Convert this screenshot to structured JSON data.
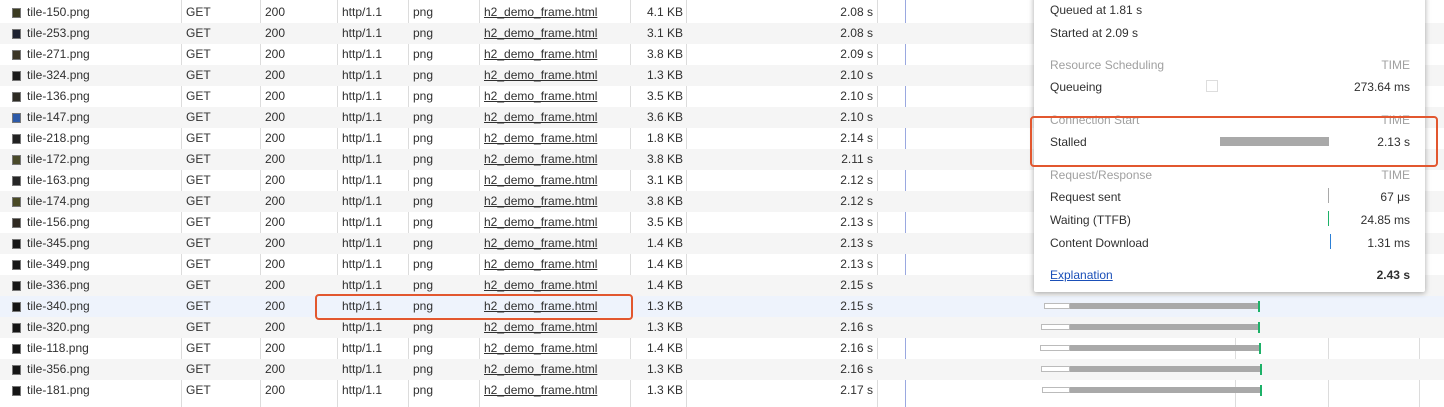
{
  "rows": [
    {
      "name": "tile-150.png",
      "method": "GET",
      "status": "200",
      "protocol": "http/1.1",
      "type": "png",
      "initiator": "h2_demo_frame.html",
      "size": "4.1 KB",
      "time": "2.08 s",
      "thumb": "#3b3b22"
    },
    {
      "name": "tile-253.png",
      "method": "GET",
      "status": "200",
      "protocol": "http/1.1",
      "type": "png",
      "initiator": "h2_demo_frame.html",
      "size": "3.1 KB",
      "time": "2.08 s",
      "thumb": "#1e2230"
    },
    {
      "name": "tile-271.png",
      "method": "GET",
      "status": "200",
      "protocol": "http/1.1",
      "type": "png",
      "initiator": "h2_demo_frame.html",
      "size": "3.8 KB",
      "time": "2.09 s",
      "thumb": "#3a3526"
    },
    {
      "name": "tile-324.png",
      "method": "GET",
      "status": "200",
      "protocol": "http/1.1",
      "type": "png",
      "initiator": "h2_demo_frame.html",
      "size": "1.3 KB",
      "time": "2.10 s",
      "thumb": "#1b1b1b"
    },
    {
      "name": "tile-136.png",
      "method": "GET",
      "status": "200",
      "protocol": "http/1.1",
      "type": "png",
      "initiator": "h2_demo_frame.html",
      "size": "3.5 KB",
      "time": "2.10 s",
      "thumb": "#2e2c24"
    },
    {
      "name": "tile-147.png",
      "method": "GET",
      "status": "200",
      "protocol": "http/1.1",
      "type": "png",
      "initiator": "h2_demo_frame.html",
      "size": "3.6 KB",
      "time": "2.10 s",
      "thumb": "#2d5aa8"
    },
    {
      "name": "tile-218.png",
      "method": "GET",
      "status": "200",
      "protocol": "http/1.1",
      "type": "png",
      "initiator": "h2_demo_frame.html",
      "size": "1.8 KB",
      "time": "2.14 s",
      "thumb": "#222"
    },
    {
      "name": "tile-172.png",
      "method": "GET",
      "status": "200",
      "protocol": "http/1.1",
      "type": "png",
      "initiator": "h2_demo_frame.html",
      "size": "3.8 KB",
      "time": "2.11 s",
      "thumb": "#4a4a2a"
    },
    {
      "name": "tile-163.png",
      "method": "GET",
      "status": "200",
      "protocol": "http/1.1",
      "type": "png",
      "initiator": "h2_demo_frame.html",
      "size": "3.1 KB",
      "time": "2.12 s",
      "thumb": "#262626"
    },
    {
      "name": "tile-174.png",
      "method": "GET",
      "status": "200",
      "protocol": "http/1.1",
      "type": "png",
      "initiator": "h2_demo_frame.html",
      "size": "3.8 KB",
      "time": "2.12 s",
      "thumb": "#4a4a26"
    },
    {
      "name": "tile-156.png",
      "method": "GET",
      "status": "200",
      "protocol": "http/1.1",
      "type": "png",
      "initiator": "h2_demo_frame.html",
      "size": "3.5 KB",
      "time": "2.13 s",
      "thumb": "#2f2a22"
    },
    {
      "name": "tile-345.png",
      "method": "GET",
      "status": "200",
      "protocol": "http/1.1",
      "type": "png",
      "initiator": "h2_demo_frame.html",
      "size": "1.4 KB",
      "time": "2.13 s",
      "thumb": "#151515"
    },
    {
      "name": "tile-349.png",
      "method": "GET",
      "status": "200",
      "protocol": "http/1.1",
      "type": "png",
      "initiator": "h2_demo_frame.html",
      "size": "1.4 KB",
      "time": "2.13 s",
      "thumb": "#151515"
    },
    {
      "name": "tile-336.png",
      "method": "GET",
      "status": "200",
      "protocol": "http/1.1",
      "type": "png",
      "initiator": "h2_demo_frame.html",
      "size": "1.4 KB",
      "time": "2.15 s",
      "thumb": "#151515"
    },
    {
      "name": "tile-340.png",
      "method": "GET",
      "status": "200",
      "protocol": "http/1.1",
      "type": "png",
      "initiator": "h2_demo_frame.html",
      "size": "1.3 KB",
      "time": "2.15 s",
      "thumb": "#151515"
    },
    {
      "name": "tile-320.png",
      "method": "GET",
      "status": "200",
      "protocol": "http/1.1",
      "type": "png",
      "initiator": "h2_demo_frame.html",
      "size": "1.3 KB",
      "time": "2.16 s",
      "thumb": "#151515"
    },
    {
      "name": "tile-118.png",
      "method": "GET",
      "status": "200",
      "protocol": "http/1.1",
      "type": "png",
      "initiator": "h2_demo_frame.html",
      "size": "1.4 KB",
      "time": "2.16 s",
      "thumb": "#151515"
    },
    {
      "name": "tile-356.png",
      "method": "GET",
      "status": "200",
      "protocol": "http/1.1",
      "type": "png",
      "initiator": "h2_demo_frame.html",
      "size": "1.3 KB",
      "time": "2.16 s",
      "thumb": "#151515"
    },
    {
      "name": "tile-181.png",
      "method": "GET",
      "status": "200",
      "protocol": "http/1.1",
      "type": "png",
      "initiator": "h2_demo_frame.html",
      "size": "1.3 KB",
      "time": "2.17 s",
      "thumb": "#151515"
    }
  ],
  "timing_popup": {
    "queued_at": "Queued at 1.81 s",
    "started_at": "Started at 2.09 s",
    "resource_scheduling": "Resource Scheduling",
    "time_header": "TIME",
    "queueing_label": "Queueing",
    "queueing_value": "273.64 ms",
    "connection_start": "Connection Start",
    "stalled_label": "Stalled",
    "stalled_value": "2.13 s",
    "request_response": "Request/Response",
    "request_sent_label": "Request sent",
    "request_sent_value": "67 μs",
    "ttfb_label": "Waiting (TTFB)",
    "ttfb_value": "24.85 ms",
    "download_label": "Content Download",
    "download_value": "1.31 ms",
    "explanation_link": "Explanation",
    "total_value": "2.43 s"
  },
  "colors": {
    "highlight": "#e2572f",
    "stalled_bar": "#a9a9a9",
    "ttfb_bar": "#1db168",
    "download_bar": "#2c7fd6",
    "link": "#1a4fb8"
  }
}
